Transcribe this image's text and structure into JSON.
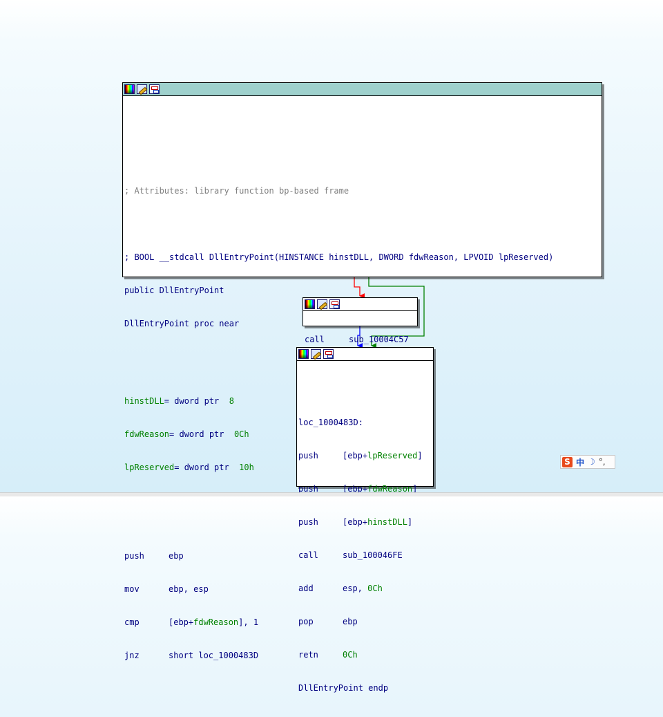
{
  "colors": {
    "edge_false": "#ff0000",
    "edge_true": "#008000",
    "edge_plain": "#0000ff",
    "code_default": "#000080",
    "comment": "#808080",
    "variable": "#008000"
  },
  "header_icons": [
    "color-palette-icon",
    "edit-pencil-icon",
    "graph-overview-icon"
  ],
  "block1": {
    "comment_attrs": "; Attributes: library function bp-based frame",
    "comment_proto": "; BOOL __stdcall DllEntryPoint(HINSTANCE hinstDLL, DWORD fdwReason, LPVOID lpReserved)",
    "public_line": "public DllEntryPoint",
    "proc_line": "DllEntryPoint proc near",
    "vars": [
      {
        "name": "hinstDLL",
        "decl": "= dword ptr  ",
        "offset": "8"
      },
      {
        "name": "fdwReason",
        "decl": "= dword ptr  ",
        "offset": "0Ch"
      },
      {
        "name": "lpReserved",
        "decl": "= dword ptr  ",
        "offset": "10h"
      }
    ],
    "instructions": [
      {
        "mnemonic": "push",
        "op_pre": "ebp",
        "op_var": "",
        "op_post": ""
      },
      {
        "mnemonic": "mov",
        "op_pre": "ebp, esp",
        "op_var": "",
        "op_post": ""
      },
      {
        "mnemonic": "cmp",
        "op_pre": "[ebp+",
        "op_var": "fdwReason",
        "op_post": "], 1"
      },
      {
        "mnemonic": "jnz",
        "op_pre": "short loc_1000483D",
        "op_var": "",
        "op_post": ""
      }
    ]
  },
  "block2": {
    "instructions": [
      {
        "mnemonic": "call",
        "op_pre": "sub_10004C57",
        "op_var": "",
        "op_post": ""
      }
    ]
  },
  "block3": {
    "label": "loc_1000483D:",
    "instructions": [
      {
        "mnemonic": "push",
        "op_pre": "[ebp+",
        "op_var": "lpReserved",
        "op_post": "]"
      },
      {
        "mnemonic": "push",
        "op_pre": "[ebp+",
        "op_var": "fdwReason",
        "op_post": "]"
      },
      {
        "mnemonic": "push",
        "op_pre": "[ebp+",
        "op_var": "hinstDLL",
        "op_post": "]"
      },
      {
        "mnemonic": "call",
        "op_pre": "sub_100046FE",
        "op_var": "",
        "op_post": ""
      },
      {
        "mnemonic": "add",
        "op_pre": "esp, ",
        "op_var": "0Ch",
        "op_post": ""
      },
      {
        "mnemonic": "pop",
        "op_pre": "ebp",
        "op_var": "",
        "op_post": ""
      },
      {
        "mnemonic": "retn",
        "op_pre": "",
        "op_var": "0Ch",
        "op_post": ""
      }
    ],
    "endp_line": "DllEntryPoint endp"
  },
  "ime": {
    "logo": "S",
    "mode": "中",
    "moon": "☽",
    "punct": "°,"
  }
}
